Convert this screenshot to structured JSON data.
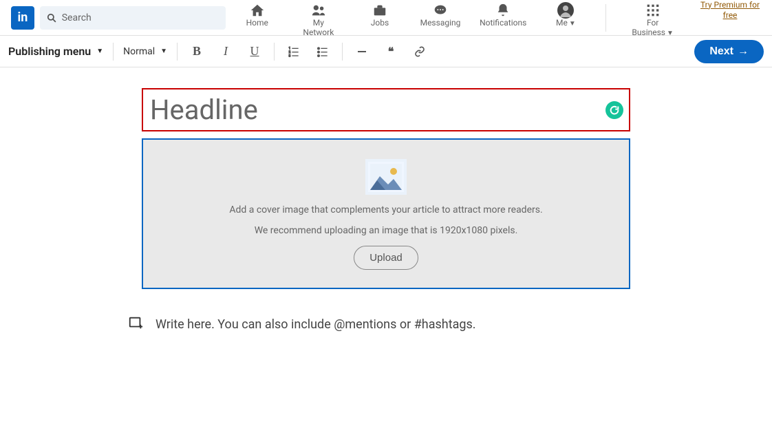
{
  "header": {
    "logo_text": "in",
    "search_placeholder": "Search",
    "nav": {
      "home": "Home",
      "network": "My Network",
      "jobs": "Jobs",
      "messaging": "Messaging",
      "notifications": "Notifications",
      "me": "Me",
      "business": "For Business",
      "premium": "Try Premium for free"
    }
  },
  "toolbar": {
    "publishing_menu": "Publishing menu",
    "style_select": "Normal",
    "next": "Next"
  },
  "editor": {
    "headline_placeholder": "Headline",
    "cover_line1": "Add a cover image that complements your article to attract more readers.",
    "cover_line2": "We recommend uploading an image that is 1920x1080 pixels.",
    "upload": "Upload",
    "body_placeholder": "Write here. You can also include @mentions or #hashtags."
  }
}
